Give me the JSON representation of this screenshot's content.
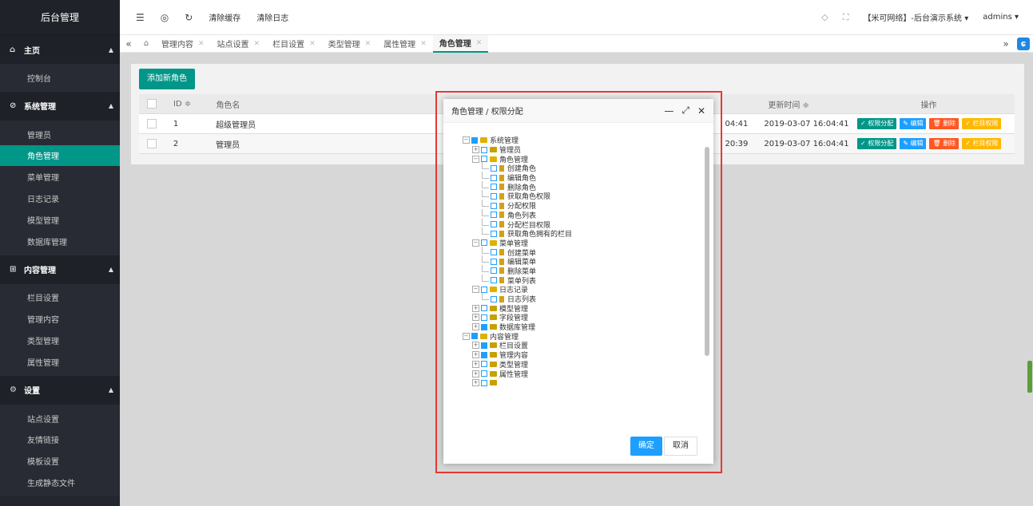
{
  "sidebar": {
    "title": "后台管理",
    "groups": [
      {
        "label": "主页",
        "icon": "home-icon",
        "items": [
          {
            "label": "控制台"
          }
        ]
      },
      {
        "label": "系统管理",
        "icon": "shield-icon",
        "items": [
          {
            "label": "管理员"
          },
          {
            "label": "角色管理"
          },
          {
            "label": "菜单管理"
          },
          {
            "label": "日志记录"
          },
          {
            "label": "模型管理"
          },
          {
            "label": "数据库管理"
          }
        ]
      },
      {
        "label": "内容管理",
        "icon": "grid-icon",
        "items": [
          {
            "label": "栏目设置"
          },
          {
            "label": "管理内容"
          },
          {
            "label": "类型管理"
          },
          {
            "label": "属性管理"
          }
        ]
      },
      {
        "label": "设置",
        "icon": "gear-icon",
        "items": [
          {
            "label": "站点设置"
          },
          {
            "label": "友情链接"
          },
          {
            "label": "模板设置"
          },
          {
            "label": "生成静态文件"
          }
        ]
      }
    ],
    "active": "角色管理"
  },
  "header": {
    "clear_cache": "清除缓存",
    "clear_log": "清除日志",
    "site": "【米可网络】-后台演示系统 ▾",
    "user": "admins ▾"
  },
  "tabs": [
    {
      "label": "管理内容"
    },
    {
      "label": "站点设置"
    },
    {
      "label": "栏目设置"
    },
    {
      "label": "类型管理"
    },
    {
      "label": "属性管理"
    },
    {
      "label": "角色管理"
    }
  ],
  "page": {
    "add_button": "添加新角色",
    "columns": {
      "id": "ID ≑",
      "name": "角色名",
      "updated": "更新时间 ≑",
      "ops": "操作"
    },
    "rows": [
      {
        "id": "1",
        "name": "超级管理员",
        "time_partial": "04:41",
        "updated": "2019-03-07 16:04:41"
      },
      {
        "id": "2",
        "name": "管理员",
        "time_partial": "20:39",
        "updated": "2019-03-07 16:04:41"
      }
    ],
    "ops": {
      "perm": "✓ 权限分配",
      "edit": "✎ 编辑",
      "delete": "🗑 删除",
      "column_perm": "✓ 栏目权限"
    }
  },
  "modal": {
    "title": "角色管理 / 权限分配",
    "ok": "确定",
    "cancel": "取消",
    "tree": [
      {
        "label": "系统管理",
        "level": 0,
        "checked": true,
        "open": true
      },
      {
        "label": "管理员",
        "level": 1,
        "checked": false,
        "open": false
      },
      {
        "label": "角色管理",
        "level": 1,
        "checked": false,
        "open": true
      },
      {
        "label": "创建角色",
        "level": 2,
        "checked": false,
        "leaf": true
      },
      {
        "label": "编辑角色",
        "level": 2,
        "checked": false,
        "leaf": true
      },
      {
        "label": "删除角色",
        "level": 2,
        "checked": false,
        "leaf": true
      },
      {
        "label": "获取角色权限",
        "level": 2,
        "checked": false,
        "leaf": true
      },
      {
        "label": "分配权限",
        "level": 2,
        "checked": false,
        "leaf": true
      },
      {
        "label": "角色列表",
        "level": 2,
        "checked": false,
        "leaf": true
      },
      {
        "label": "分配栏目权限",
        "level": 2,
        "checked": false,
        "leaf": true
      },
      {
        "label": "获取角色拥有的栏目",
        "level": 2,
        "checked": false,
        "leaf": true
      },
      {
        "label": "菜单管理",
        "level": 1,
        "checked": false,
        "open": true
      },
      {
        "label": "创建菜单",
        "level": 2,
        "checked": false,
        "leaf": true
      },
      {
        "label": "编辑菜单",
        "level": 2,
        "checked": false,
        "leaf": true
      },
      {
        "label": "删除菜单",
        "level": 2,
        "checked": false,
        "leaf": true
      },
      {
        "label": "菜单列表",
        "level": 2,
        "checked": false,
        "leaf": true
      },
      {
        "label": "日志记录",
        "level": 1,
        "checked": false,
        "open": true
      },
      {
        "label": "日志列表",
        "level": 2,
        "checked": false,
        "leaf": true
      },
      {
        "label": "模型管理",
        "level": 1,
        "checked": false,
        "open": false
      },
      {
        "label": "字段管理",
        "level": 1,
        "checked": false,
        "open": false
      },
      {
        "label": "数据库管理",
        "level": 1,
        "checked": true,
        "open": false
      },
      {
        "label": "内容管理",
        "level": 0,
        "checked": true,
        "open": true
      },
      {
        "label": "栏目设置",
        "level": 1,
        "checked": true,
        "open": false
      },
      {
        "label": "管理内容",
        "level": 1,
        "checked": true,
        "open": false
      },
      {
        "label": "类型管理",
        "level": 1,
        "checked": false,
        "open": false
      },
      {
        "label": "属性管理",
        "level": 1,
        "checked": false,
        "open": false
      },
      {
        "label": "",
        "level": 1,
        "checked": false,
        "open": false
      }
    ]
  }
}
